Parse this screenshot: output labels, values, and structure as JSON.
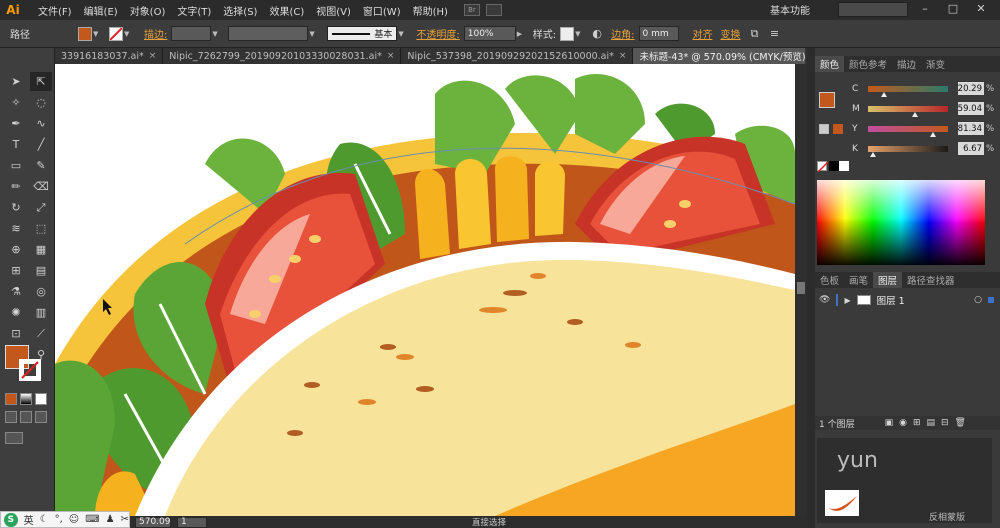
{
  "app": {
    "logo": "Ai"
  },
  "menu": [
    "文件(F)",
    "编辑(E)",
    "对象(O)",
    "文字(T)",
    "选择(S)",
    "效果(C)",
    "视图(V)",
    "窗口(W)",
    "帮助(H)"
  ],
  "menu_bar": {
    "br_label": "Br",
    "workspace": "基本功能",
    "search_placeholder": "",
    "window_controls": [
      "–",
      "□",
      "✕"
    ]
  },
  "control_bar": {
    "selection_label": "路径",
    "fill_color": "#c2581c",
    "stroke_link": "描边:",
    "stroke_style_label": "基本",
    "opacity_link": "不透明度:",
    "opacity_value": "100%",
    "style_label": "样式:",
    "corner_link": "边角:",
    "corner_value": "0 mm",
    "align_link": "对齐",
    "transform_link": "变换"
  },
  "tabs": [
    {
      "label": "33916183037.ai*",
      "active": false
    },
    {
      "label": "Nipic_7262799_20190920103330028031.ai*",
      "active": false
    },
    {
      "label": "Nipic_537398_20190929202152610000.ai*",
      "active": false
    },
    {
      "label": "未标题-43* @ 570.09% (CMYK/预览)",
      "active": true
    }
  ],
  "color_panel": {
    "tabs": [
      "颜色",
      "颜色参考",
      "描边",
      "渐变"
    ],
    "active_swatch": "#c2581c",
    "channels": [
      {
        "label": "C",
        "value": "20.29",
        "fraction": 0.2029,
        "gradient": [
          "#c45a1b",
          "#2a7a6a"
        ]
      },
      {
        "label": "M",
        "value": "59.04",
        "fraction": 0.5904,
        "gradient": [
          "#d8c06a",
          "#b8262a"
        ]
      },
      {
        "label": "Y",
        "value": "81.34",
        "fraction": 0.8134,
        "gradient": [
          "#c04fa0",
          "#c2581c"
        ]
      },
      {
        "label": "K",
        "value": "6.67",
        "fraction": 0.0667,
        "gradient": [
          "#e7a26a",
          "#1a1a1a"
        ]
      }
    ],
    "percent": "%"
  },
  "layers_panel": {
    "tabs": [
      "色板",
      "画笔",
      "图层",
      "路径查找器"
    ],
    "layer_name": "图层 1",
    "footer_count": "1 个图层"
  },
  "status_bar": {
    "zoom": "570.09",
    "page": "1",
    "tool": "直接选择"
  },
  "ime": {
    "logo": "S",
    "lang": "英"
  },
  "watermark": "yun",
  "bg_text": "反相蒙版"
}
